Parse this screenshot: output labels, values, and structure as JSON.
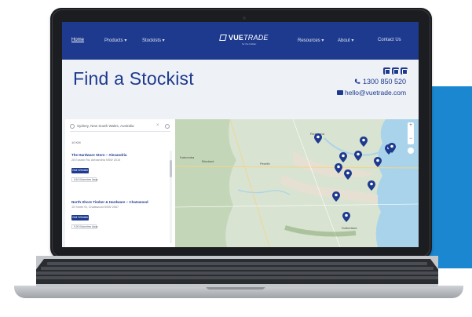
{
  "colors": {
    "accent": "#1a87d0",
    "brand_navy": "#1e3a8e",
    "map_land": "#d8e3d1",
    "map_water": "#a9d3ea",
    "pin": "#1e3a8e"
  },
  "nav": {
    "items": [
      "Home",
      "Products",
      "Stockists",
      "Resources",
      "About",
      "Contact Us"
    ],
    "active": "Home",
    "logo": {
      "brand": "VUE",
      "brand_italic": "TRADE",
      "tagline": "for the builder"
    }
  },
  "header": {
    "title": "Find a Stockist",
    "phone": "1300 850 520",
    "email": "hello@vuetrade.com",
    "social_icons": [
      "facebook-icon",
      "instagram-icon",
      "linkedin-icon"
    ]
  },
  "search": {
    "value": "Sydney, New South Wales, Australia",
    "clear": "×"
  },
  "filter_label": "10 KM",
  "results": [
    {
      "title": "The Hardware Store – Alexandria",
      "address": "28 Euston Rd, Alexandria NSW 2015",
      "button": "Visit Website",
      "badge": "6.54 Kilometres Away"
    },
    {
      "title": "North Shore Timber & Hardware – Chatswood",
      "address": "15 Smith St, Chatswood NSW 2067",
      "button": "Visit Website",
      "badge": "9.26 Kilometres Away"
    }
  ],
  "map": {
    "places": [
      "Richmond",
      "Penrith",
      "Katoomba",
      "Blaxland",
      "Sutherland"
    ],
    "zoom_in": "+",
    "zoom_out": "−",
    "pin_count": 12
  }
}
